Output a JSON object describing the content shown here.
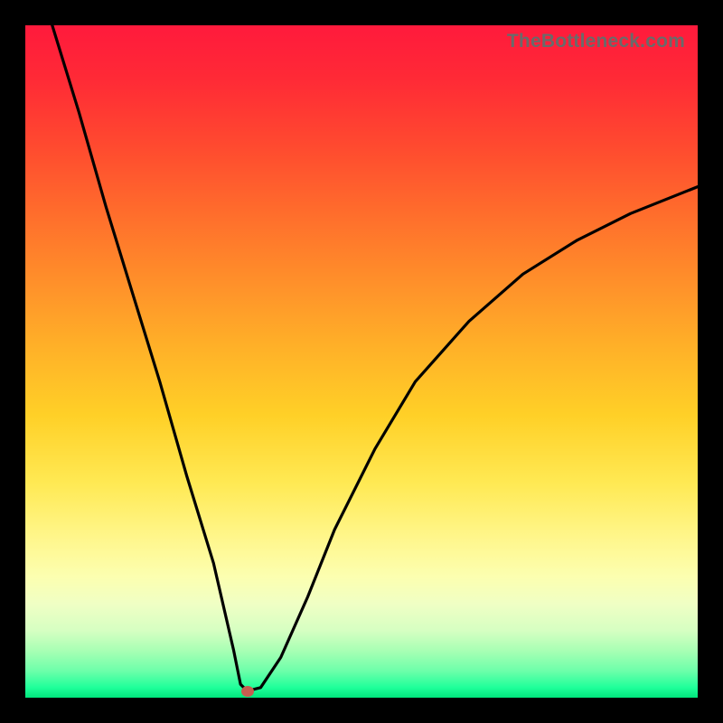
{
  "watermark": "TheBottleneck.com",
  "chart_data": {
    "type": "line",
    "title": "",
    "xlabel": "",
    "ylabel": "",
    "xlim": [
      0,
      100
    ],
    "ylim": [
      0,
      100
    ],
    "grid": false,
    "legend": false,
    "background": "rainbow-vertical-gradient (red top → green bottom)",
    "series": [
      {
        "name": "bottleneck-curve",
        "x": [
          4,
          8,
          12,
          16,
          20,
          24,
          28,
          31,
          32,
          33,
          35,
          38,
          42,
          46,
          52,
          58,
          66,
          74,
          82,
          90,
          100
        ],
        "values": [
          100,
          87,
          73,
          60,
          47,
          33,
          20,
          7,
          2,
          1,
          1.5,
          6,
          15,
          25,
          37,
          47,
          56,
          63,
          68,
          72,
          76
        ]
      }
    ],
    "annotations": [
      {
        "name": "minimum-point",
        "x": 33,
        "y": 1,
        "marker": "red-dot"
      }
    ]
  }
}
